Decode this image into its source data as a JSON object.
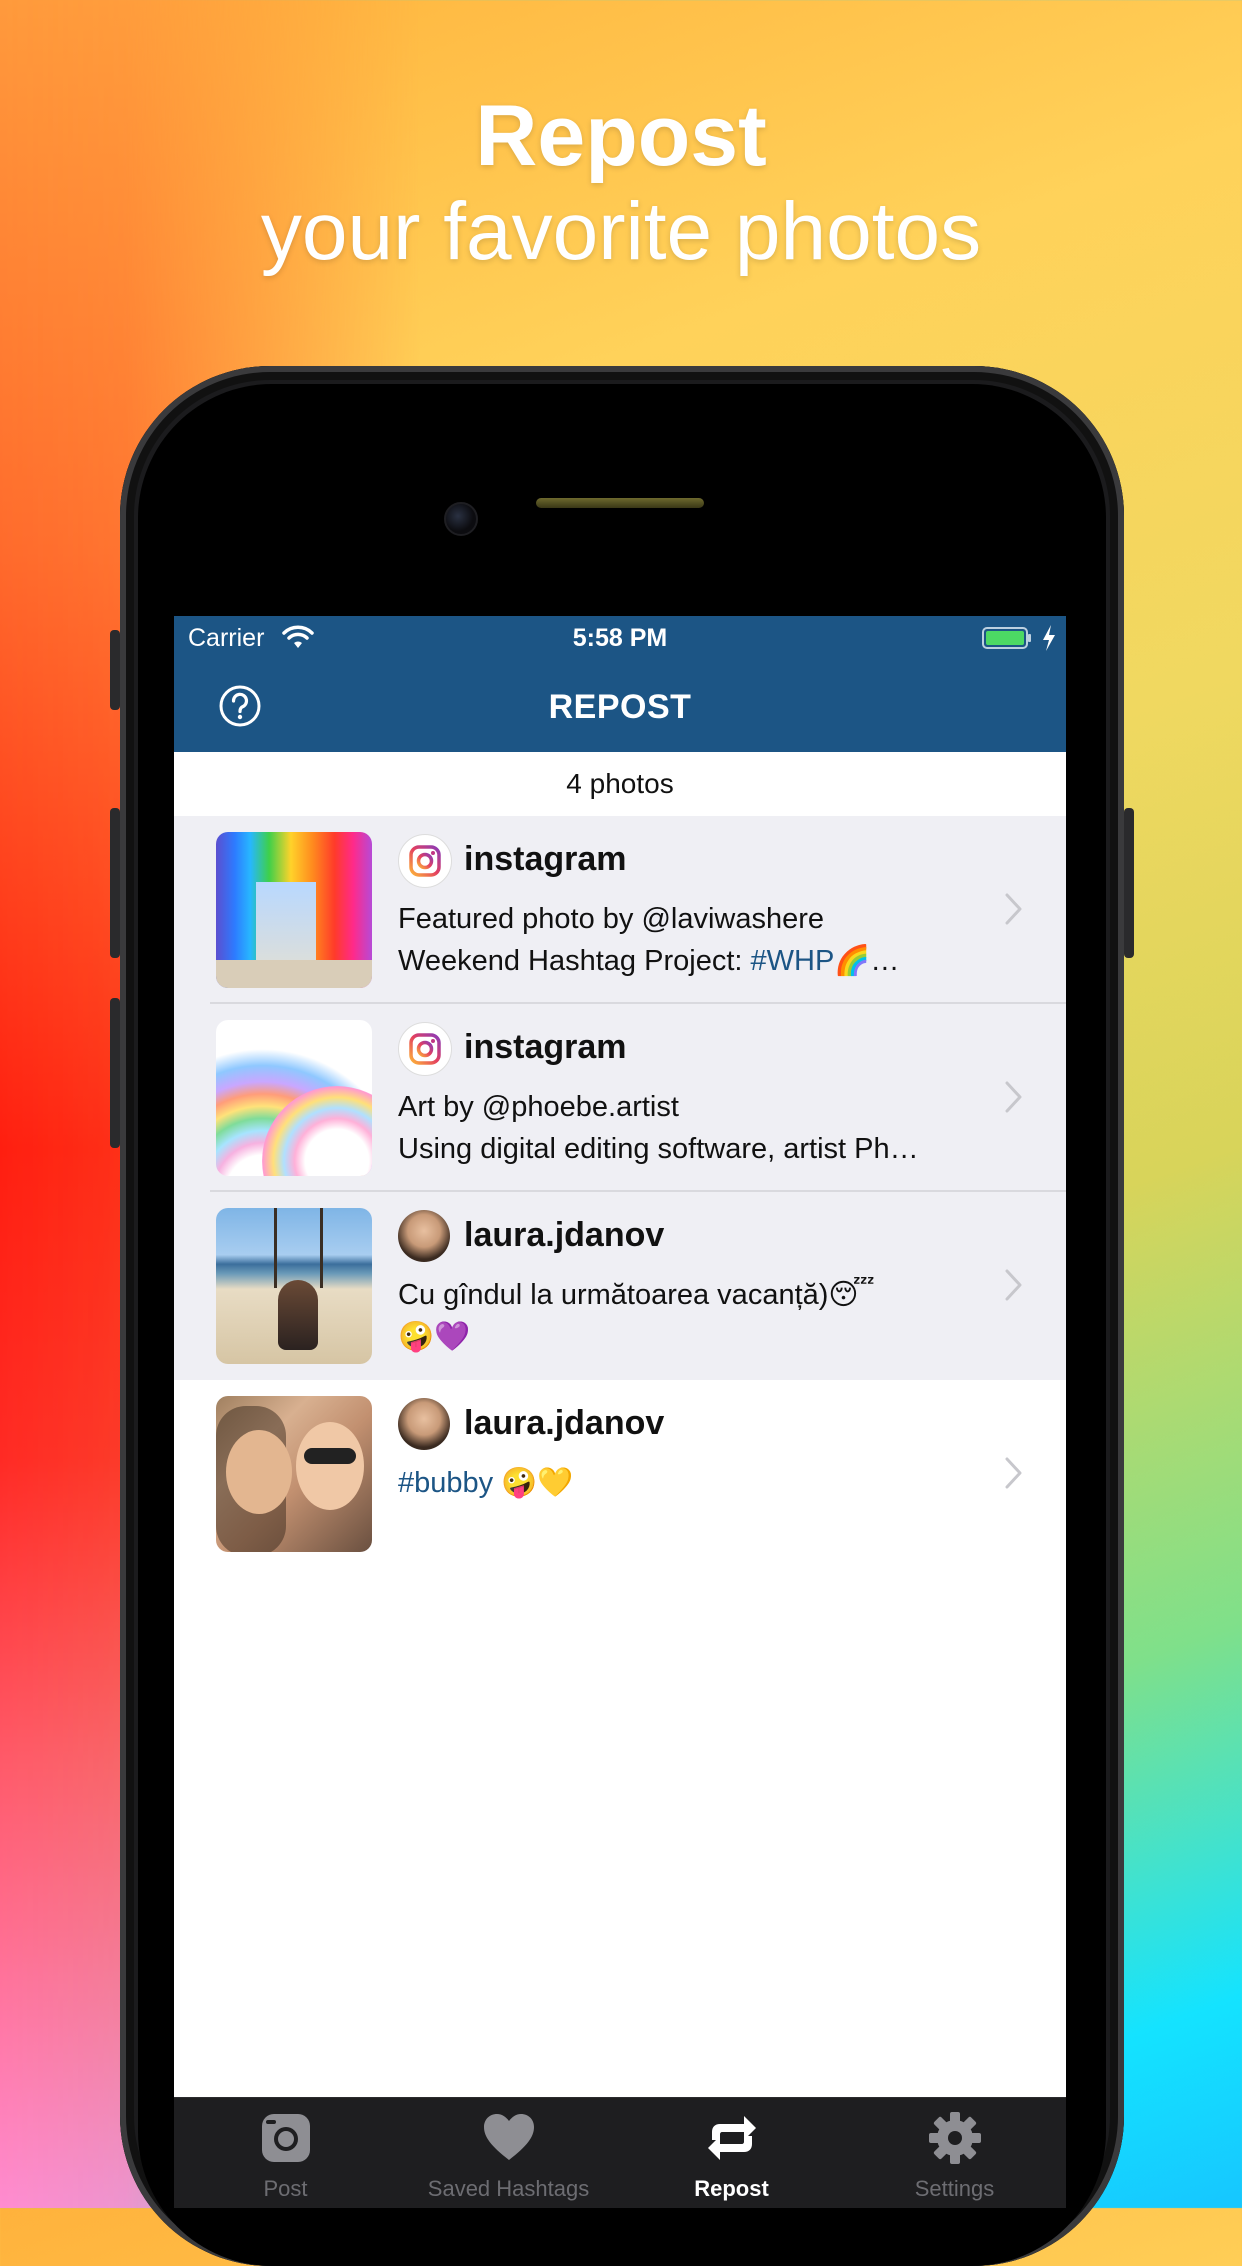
{
  "headline": {
    "title": "Repost",
    "subtitle": "your favorite photos"
  },
  "status_bar": {
    "carrier": "Carrier",
    "time": "5:58 PM"
  },
  "nav": {
    "title": "REPOST"
  },
  "photo_count": "4 photos",
  "posts": [
    {
      "username": "instagram",
      "caption_line1": "Featured photo by @laviwashere",
      "caption_line2_prefix": "Weekend Hashtag Project: ",
      "caption_line2_hashtag": "#WHP",
      "caption_line2_suffix": "🌈…"
    },
    {
      "username": "instagram",
      "caption_line1": "Art by @phoebe.artist",
      "caption_line2": "Using digital editing software, artist Ph…"
    },
    {
      "username": "laura.jdanov",
      "caption_line1": "Cu gîndul la următoarea vacanță)😴",
      "caption_line2": "🤪💜"
    },
    {
      "username": "laura.jdanov",
      "caption_hashtag": "#bubby",
      "caption_suffix": " 🤪💛"
    }
  ],
  "tabs": [
    {
      "label": "Post",
      "icon": "camera-icon",
      "active": false
    },
    {
      "label": "Saved Hashtags",
      "icon": "heart-icon",
      "active": false
    },
    {
      "label": "Repost",
      "icon": "repost-icon",
      "active": true
    },
    {
      "label": "Settings",
      "icon": "gear-icon",
      "active": false
    }
  ],
  "colors": {
    "nav_bar": "#1c5585",
    "hashtag": "#1c5585",
    "row_highlight": "#efeff4",
    "tab_bar": "#1e1e20"
  }
}
